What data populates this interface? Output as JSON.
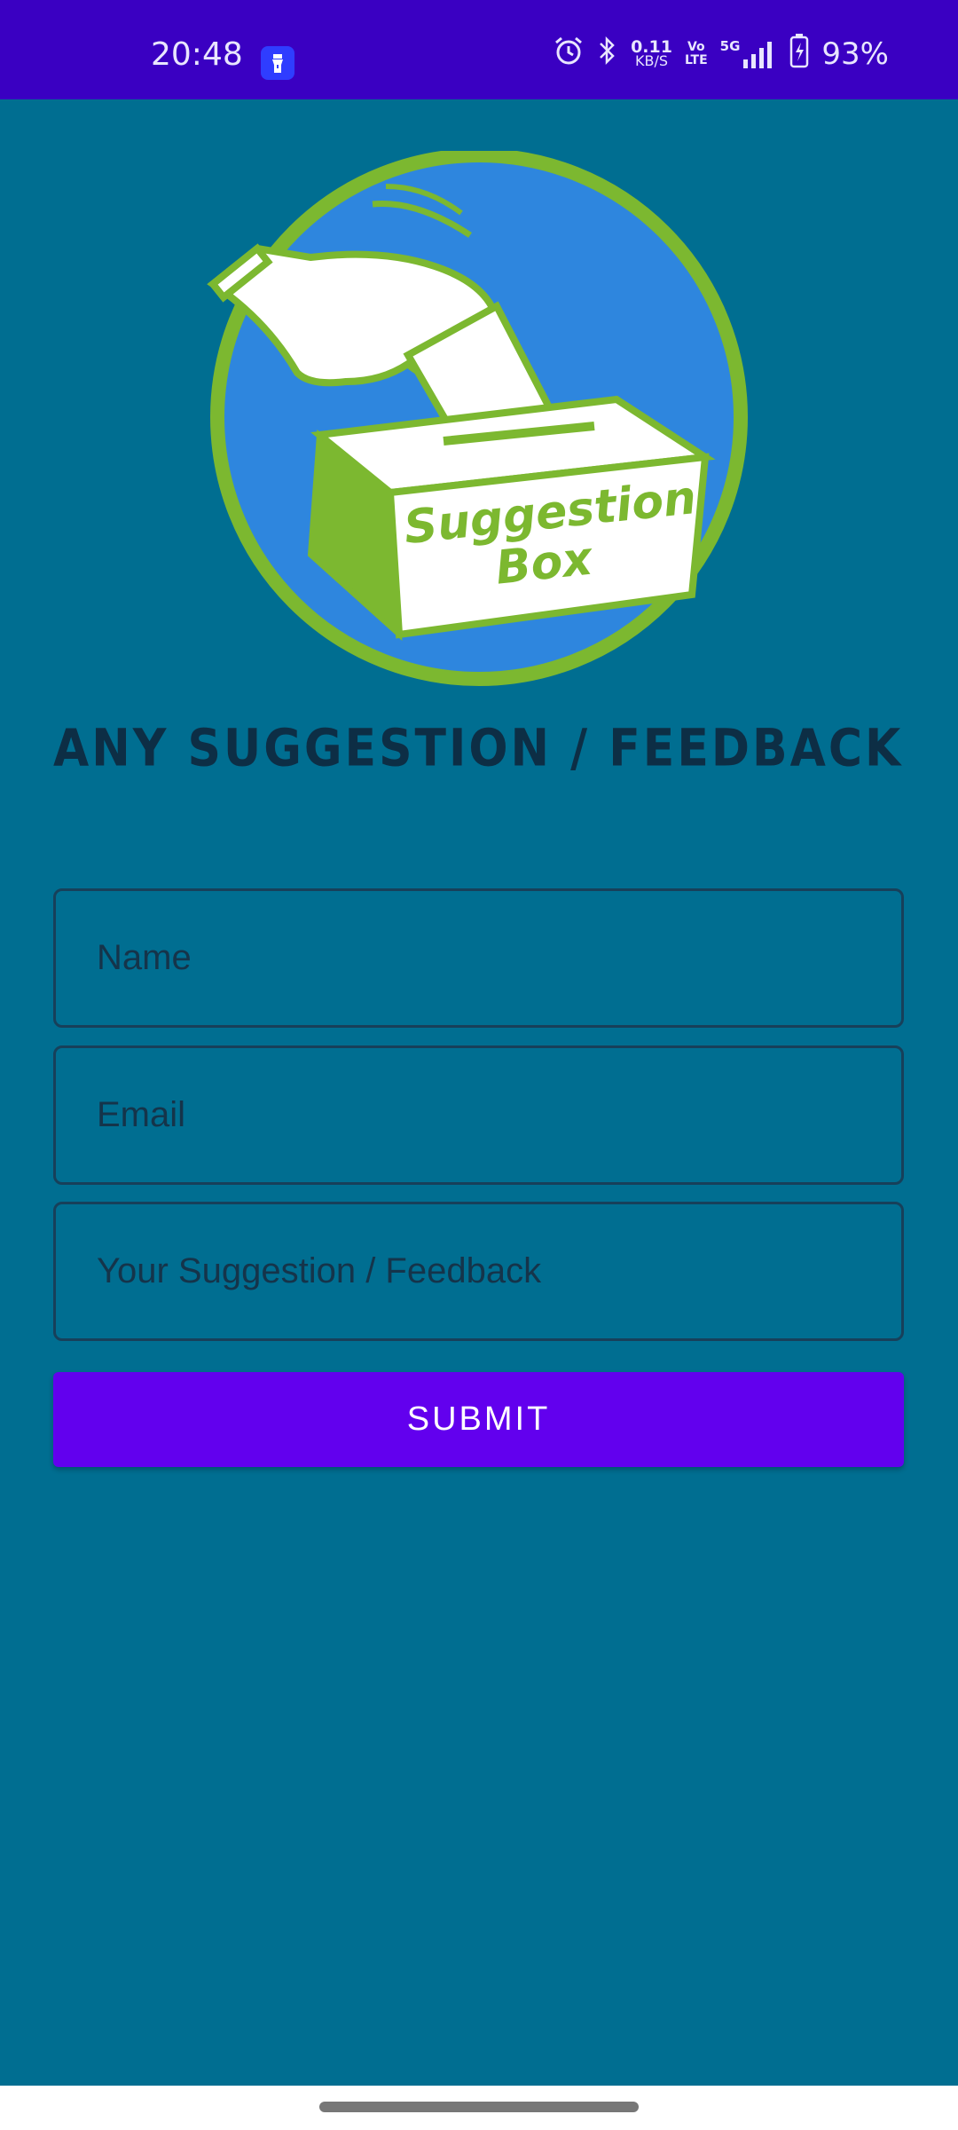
{
  "status_bar": {
    "time": "20:48",
    "net_speed_value": "0.11",
    "net_speed_unit": "KB/S",
    "volte_top": "Vo",
    "volte_bottom": "LTE",
    "network_type": "5G",
    "battery": "93%",
    "icons": [
      "torch-app-icon",
      "alarm-icon",
      "bluetooth-icon",
      "signal-icon",
      "battery-icon"
    ]
  },
  "logo": {
    "line1": "Suggestion",
    "line2": "Box"
  },
  "heading": "ANY SUGGESTION / FEEDBACK",
  "form": {
    "name_placeholder": "Name",
    "name_value": "",
    "email_placeholder": "Email",
    "email_value": "",
    "feedback_placeholder": "Your Suggestion / Feedback",
    "feedback_value": "",
    "submit_label": "SUBMIT"
  },
  "colors": {
    "status_bar": "#3a00c2",
    "background": "#006e91",
    "button": "#6200ee",
    "logo_green": "#7cb830",
    "logo_blue": "#2e86de"
  }
}
